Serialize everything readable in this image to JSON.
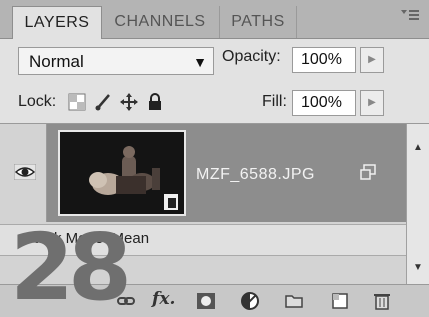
{
  "tabs": [
    {
      "label": "LAYERS",
      "active": true
    },
    {
      "label": "CHANNELS",
      "active": false
    },
    {
      "label": "PATHS",
      "active": false
    }
  ],
  "blend_mode": {
    "value": "Normal"
  },
  "opacity": {
    "label": "Opacity:",
    "value": "100%"
  },
  "lock": {
    "label": "Lock:",
    "icons": [
      "lock-transparent-icon",
      "lock-brush-icon",
      "lock-move-icon",
      "lock-all-icon"
    ]
  },
  "fill": {
    "label": "Fill:",
    "value": "100%"
  },
  "layer": {
    "name": "MZF_6588.JPG",
    "visible": true,
    "smart_object": true
  },
  "stack_mode": {
    "text": "Stack Mode: Mean"
  },
  "bottom_icons": [
    "link-icon",
    "fx-icon",
    "mask-icon",
    "adjustment-icon",
    "group-folder-icon",
    "new-layer-icon",
    "trash-icon"
  ],
  "fx_label": "fx.",
  "overlay_number": "28",
  "colors": {
    "selected_layer": "#8d8d8d",
    "panel": "#e2e2e2",
    "overlay": "#6f6f6f"
  }
}
